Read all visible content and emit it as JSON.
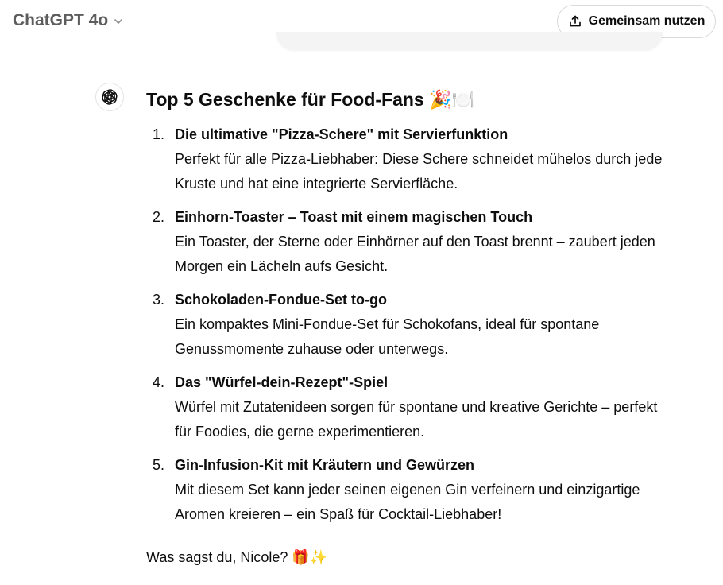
{
  "header": {
    "model_name": "ChatGPT 4o",
    "share_label": "Gemeinsam nutzen"
  },
  "message": {
    "title": "Top 5 Geschenke für Food-Fans 🎉🍽️",
    "items": [
      {
        "number": "1.",
        "title": "Die ultimative \"Pizza-Schere\" mit Servierfunktion",
        "description": "Perfekt für alle Pizza-Liebhaber: Diese Schere schneidet mühelos durch jede Kruste und hat eine integrierte Servierfläche."
      },
      {
        "number": "2.",
        "title": "Einhorn-Toaster – Toast mit einem magischen Touch",
        "description": "Ein Toaster, der Sterne oder Einhörner auf den Toast brennt – zaubert jeden Morgen ein Lächeln aufs Gesicht."
      },
      {
        "number": "3.",
        "title": "Schokoladen-Fondue-Set to-go",
        "description": "Ein kompaktes Mini-Fondue-Set für Schokofans, ideal für spontane Genussmomente zuhause oder unterwegs."
      },
      {
        "number": "4.",
        "title": "Das \"Würfel-dein-Rezept\"-Spiel",
        "description": "Würfel mit Zutatenideen sorgen für spontane und kreative Gerichte – perfekt für Foodies, die gerne experimentieren."
      },
      {
        "number": "5.",
        "title": "Gin-Infusion-Kit mit Kräutern und Gewürzen",
        "description": "Mit diesem Set kann jeder seinen eigenen Gin verfeinern und einzigartige Aromen kreieren – ein Spaß für Cocktail-Liebhaber!"
      }
    ],
    "closing": "Was sagst du, Nicole? 🎁✨"
  },
  "icons": {
    "model_dropdown": "chevron-down-icon",
    "share": "share-upload-icon",
    "assistant_avatar": "openai-logo-icon"
  }
}
